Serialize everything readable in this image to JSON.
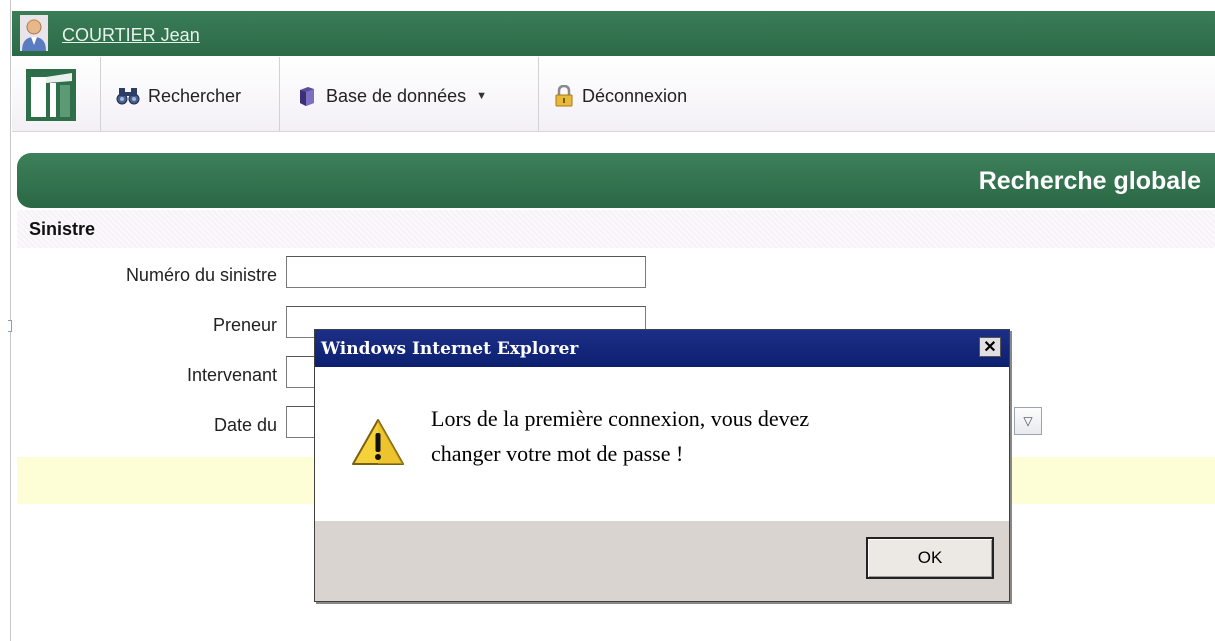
{
  "user": {
    "name": "COURTIER Jean"
  },
  "toolbar": {
    "search_label": "Rechercher",
    "database_label": "Base de données",
    "logout_label": "Déconnexion"
  },
  "section": {
    "title": "Recherche globale",
    "subtitle": "Sinistre"
  },
  "form": {
    "claim_number_label": "Numéro du sinistre",
    "policyholder_label": "Preneur",
    "party_label": "Intervenant",
    "date_from_label": "Date du",
    "claim_number_value": "",
    "policyholder_value": "",
    "party_value": "",
    "date_from_value": ""
  },
  "dialog": {
    "title": "Windows Internet Explorer",
    "close_glyph": "✕",
    "message_line1": "Lors de la première connexion, vous devez",
    "message_line2": "changer votre mot de passe !",
    "ok_label": "OK"
  },
  "colors": {
    "header_green": "#2c6a47",
    "dialog_title_blue": "#0c1f70",
    "footer_gray": "#d9d4cf",
    "notice_yellow": "#fdfdd6"
  }
}
